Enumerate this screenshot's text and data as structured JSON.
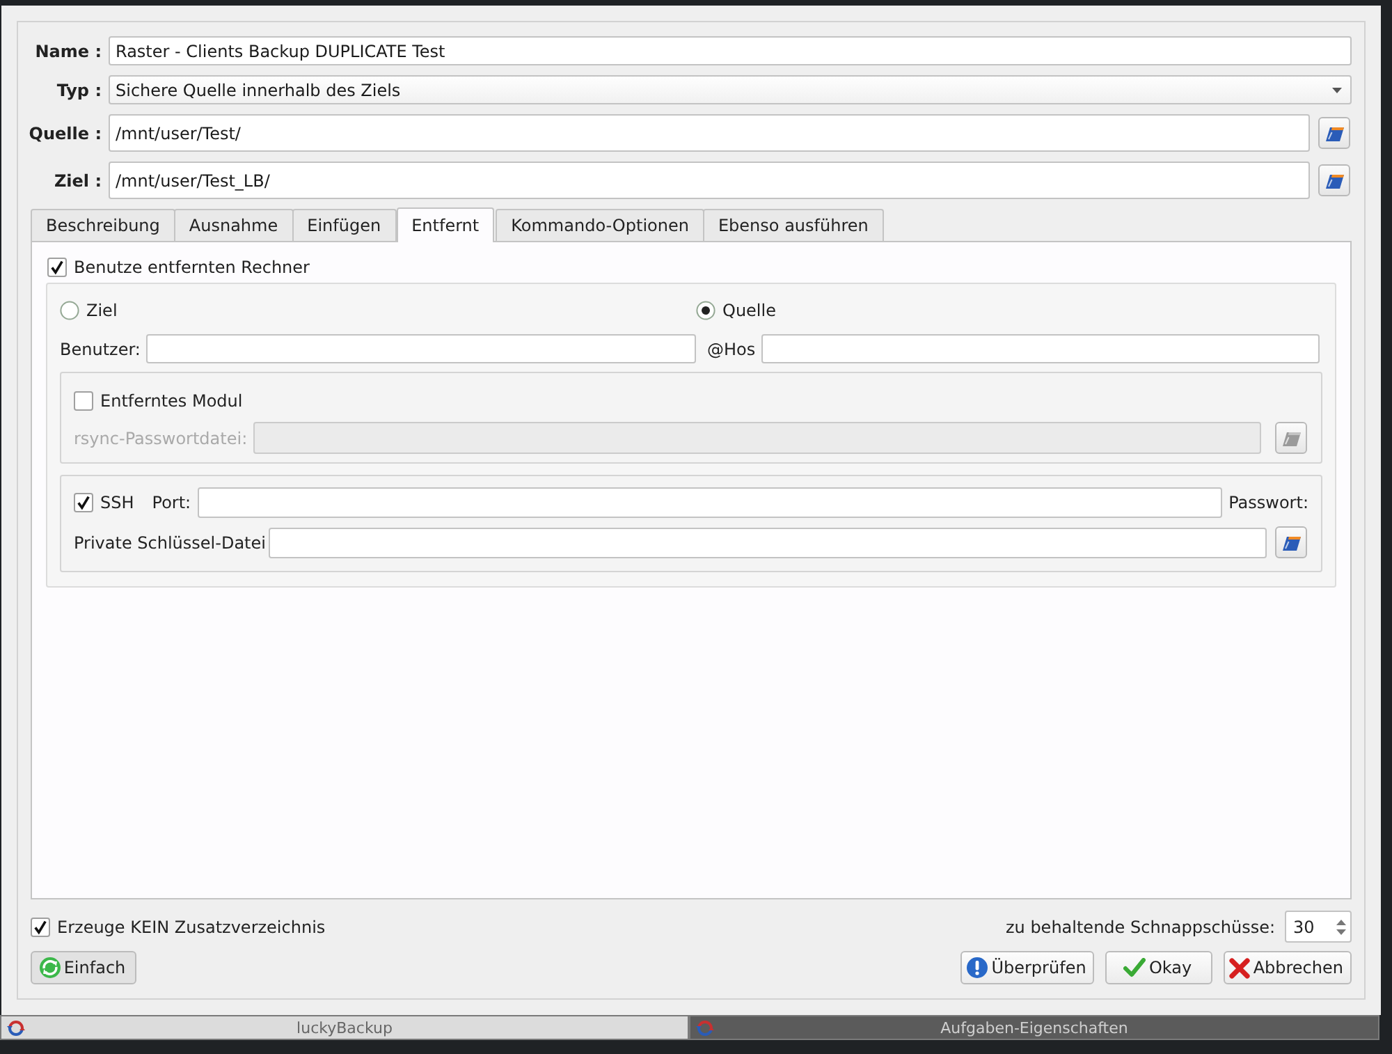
{
  "form": {
    "fields": [
      {
        "label": "Name :",
        "value": "Raster - Clients Backup DUPLICATE Test",
        "kind": "text"
      },
      {
        "label": "Typ :",
        "value": "Sichere Quelle innerhalb des Ziels",
        "kind": "combo"
      },
      {
        "label": "Quelle :",
        "value": "/mnt/user/Test/",
        "kind": "path"
      },
      {
        "label": "Ziel :",
        "value": "/mnt/user/Test_LB/",
        "kind": "path"
      }
    ]
  },
  "tabs": [
    {
      "label": "Beschreibung",
      "selected": false
    },
    {
      "label": "Ausnahme",
      "selected": false
    },
    {
      "label": "Einfügen",
      "selected": false
    },
    {
      "label": "Entfernt",
      "selected": true
    },
    {
      "label": "Kommando-Optionen",
      "selected": false
    },
    {
      "label": "Ebenso ausführen",
      "selected": false
    }
  ],
  "remote": {
    "use_remote": {
      "label": "Benutze entfernten Rechner",
      "checked": true
    },
    "direction": [
      {
        "label": "Ziel",
        "selected": false
      },
      {
        "label": "Quelle",
        "selected": true
      }
    ],
    "user_label": "Benutzer:",
    "host_label": "@Hos",
    "module": {
      "label": "Entferntes Modul",
      "checked": false,
      "password_file": {
        "label": "rsync-Passwortdatei:",
        "disabled": true
      }
    },
    "ssh": {
      "label": "SSH",
      "checked": true,
      "port_label": "Port:",
      "password_label": "Passwort:",
      "key_file_label": "Private Schlüssel-Datei"
    }
  },
  "no_extra_dir": {
    "label": "Erzeuge KEIN Zusatzverzeichnis",
    "checked": true
  },
  "snapshots": {
    "label": "zu behaltende Schnappschüsse:",
    "value": "30"
  },
  "mode_button": {
    "label": "Einfach"
  },
  "buttons": [
    {
      "label": "Überprüfen",
      "kind": "validate"
    },
    {
      "label": "Okay",
      "kind": "ok"
    },
    {
      "label": "Abbrechen",
      "kind": "cancel"
    }
  ],
  "taskbar": [
    {
      "label": "luckyBackup",
      "selected": false
    },
    {
      "label": "Aufgaben-Eigenschaften",
      "selected": true
    }
  ]
}
